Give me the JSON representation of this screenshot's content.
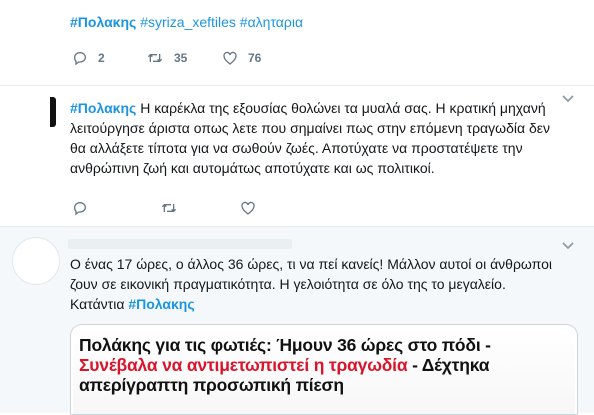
{
  "tweets": [
    {
      "hashtags": [
        "#Πολακης",
        "#syriza_xeftiles",
        "#αληταρια"
      ],
      "actions": {
        "replies": "2",
        "retweets": "35",
        "likes": "76"
      }
    },
    {
      "lead_hashtag": "#Πολακης",
      "lines": [
        " Η καρέκλα της εξουσίας θολώνει τα μυαλά σας. Η κρατική μηχανή",
        "λειτούργησε άριστα οπως λετε που σημαίνει πως στην επόμενη τραγωδία δεν",
        "θα αλλάξετε τίποτα για να σωθούν ζωές. Αποτύχατε να προστατέψετε την",
        "ανθρώπινη ζωή και αυτομάτως αποτύχατε και ως πολιτικοί."
      ]
    },
    {
      "lines": [
        "Ο ένας 17 ώρες, ο άλλος 36 ώρες, τι να πεί κανείς! Μάλλον αυτοί οι άνθρωποι",
        "ζουν σε εικονική πραγματικότητα. Η γελοιότητα σε όλο της το μεγαλείο."
      ],
      "last_line_text": "Κατάντια ",
      "last_line_hashtag": "#Πολακης",
      "card": {
        "headline_black_1": "Πολάκης για τις φωτιές: Ήμουν 36 ώρες στο πόδι -",
        "headline_red": "Συνέβαλα να αντιμετωπιστεί η τραγωδία",
        "headline_black_2": " - Δέχτηκα",
        "headline_black_3": "απερίγραπτη προσωπική πίεση"
      }
    }
  ],
  "colors": {
    "link": "#1b95e0",
    "icon": "#657786",
    "card_red": "#d9142b",
    "divider": "#e6ecf0"
  },
  "icons": [
    "reply-icon",
    "retweet-icon",
    "like-icon",
    "chevron-down-icon"
  ]
}
